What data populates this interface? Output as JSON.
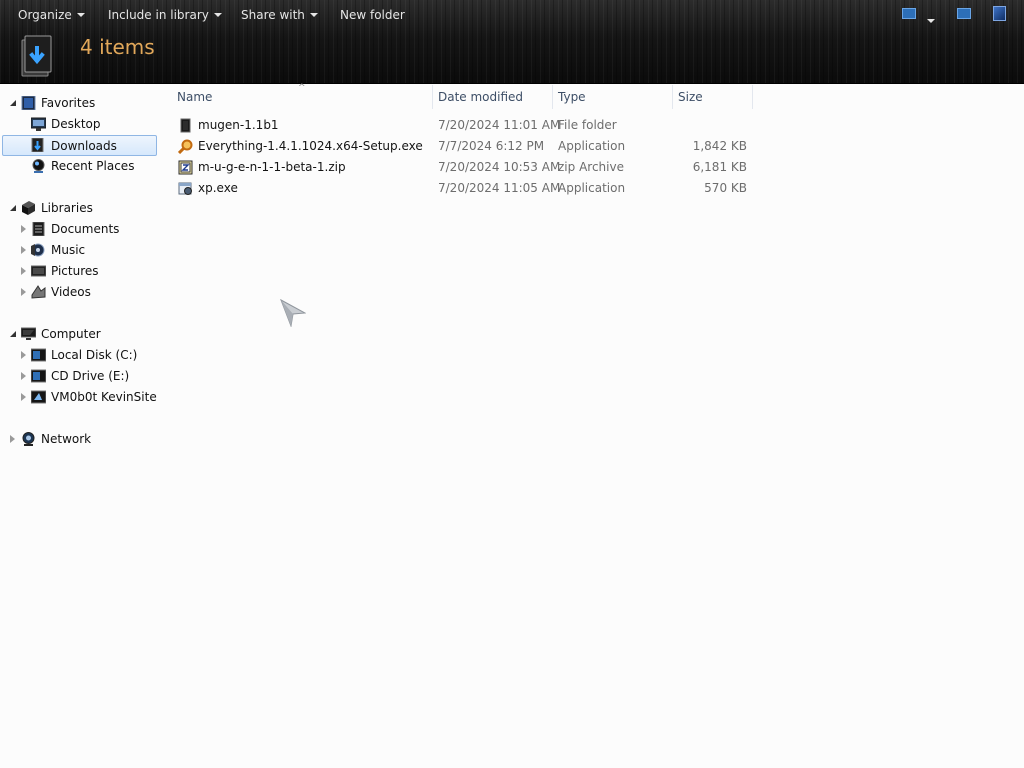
{
  "toolbar": {
    "organize": "Organize",
    "include_in_library": "Include in library",
    "share_with": "Share with",
    "new_folder": "New folder",
    "view_icon": "view-options-icon",
    "preview_icon": "preview-pane-icon",
    "help_icon": "help-icon"
  },
  "header": {
    "item_count": "4 items",
    "folder_icon": "downloads-folder-icon"
  },
  "nav": {
    "favorites": {
      "label": "Favorites",
      "items": [
        {
          "label": "Desktop",
          "icon": "desktop-icon"
        },
        {
          "label": "Downloads",
          "icon": "downloads-icon",
          "selected": true
        },
        {
          "label": "Recent Places",
          "icon": "recent-places-icon"
        }
      ]
    },
    "libraries": {
      "label": "Libraries",
      "items": [
        {
          "label": "Documents",
          "icon": "documents-icon"
        },
        {
          "label": "Music",
          "icon": "music-icon"
        },
        {
          "label": "Pictures",
          "icon": "pictures-icon"
        },
        {
          "label": "Videos",
          "icon": "videos-icon"
        }
      ]
    },
    "computer": {
      "label": "Computer",
      "items": [
        {
          "label": "Local Disk (C:)",
          "icon": "disk-icon"
        },
        {
          "label": "CD Drive (E:)",
          "icon": "cd-drive-icon"
        },
        {
          "label": "VM0b0t KevinSite",
          "icon": "network-drive-icon"
        }
      ]
    },
    "network": {
      "label": "Network",
      "icon": "network-icon"
    }
  },
  "columns": {
    "name": "Name",
    "date": "Date modified",
    "type": "Type",
    "size": "Size"
  },
  "files": [
    {
      "name": "mugen-1.1b1",
      "date": "7/20/2024 11:01 AM",
      "type": "File folder",
      "size": "",
      "icon": "folder-icon"
    },
    {
      "name": "Everything-1.4.1.1024.x64-Setup.exe",
      "date": "7/7/2024 6:12 PM",
      "type": "Application",
      "size": "1,842 KB",
      "icon": "magnifier-app-icon"
    },
    {
      "name": "m-u-g-e-n-1-1-beta-1.zip",
      "date": "7/20/2024 10:53 AM",
      "type": "zip Archive",
      "size": "6,181 KB",
      "icon": "zip-archive-icon"
    },
    {
      "name": "xp.exe",
      "date": "7/20/2024 11:05 AM",
      "type": "Application",
      "size": "570 KB",
      "icon": "application-icon"
    }
  ],
  "colors": {
    "header_bg": "#151515",
    "item_count": "#e2a85a",
    "selection_bg": "#d6e8fc",
    "selection_border": "#8fb6e4",
    "column_header_text": "#3d4e66",
    "secondary_text": "#6d6d6d"
  }
}
